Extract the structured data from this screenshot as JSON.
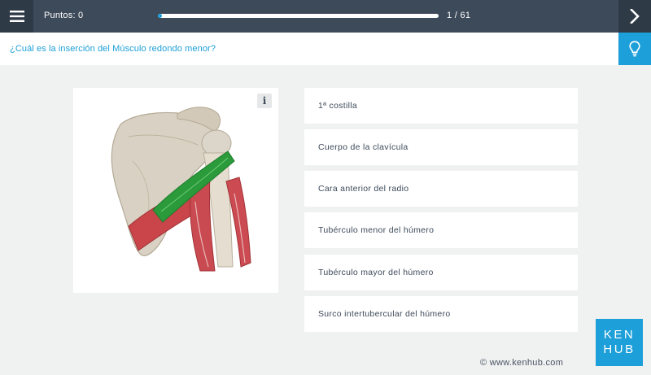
{
  "header": {
    "menu_icon": "hamburger-menu-icon",
    "score_label": "Puntos: 0",
    "progress": {
      "current": 1,
      "total": 61,
      "label": "1 / 61"
    },
    "next_icon": "chevron-right-icon"
  },
  "question": {
    "text": "¿Cuál es la inserción del Músculo redondo menor?",
    "hint_icon": "lightbulb-icon"
  },
  "image": {
    "info_label": "i",
    "muscle_highlight_color": "#2a9a3a",
    "muscle_color": "#c9454a",
    "bone_color": "#d9d2c4"
  },
  "answers": [
    {
      "label": "1ª costilla"
    },
    {
      "label": "Cuerpo de la clavícula"
    },
    {
      "label": "Cara anterior del radio"
    },
    {
      "label": "Tubérculo menor del húmero"
    },
    {
      "label": "Tubérculo mayor del húmero"
    },
    {
      "label": "Surco intertubercular del húmero"
    }
  ],
  "brand": {
    "logo_line1": "KEN",
    "logo_line2": "HUB",
    "copyright": "© www.kenhub.com",
    "accent_color": "#1d9fd9",
    "dark_color": "#3d4a5a"
  }
}
